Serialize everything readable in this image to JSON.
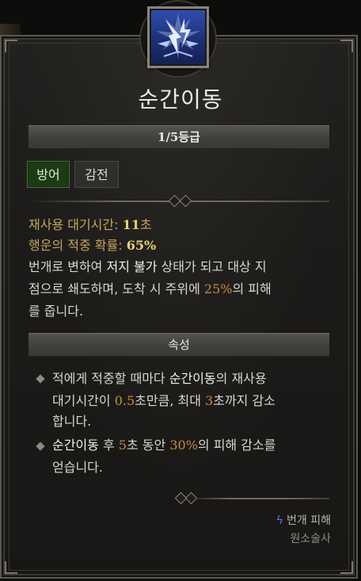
{
  "skill": {
    "name": "순간이동",
    "rank": "1/5등급",
    "tags": [
      "방어",
      "감전"
    ]
  },
  "stats": {
    "cooldown_label": "재사용 대기시간:",
    "cooldown_value": "11",
    "cooldown_unit": "초",
    "luck_label": "행운의 적중 확률:",
    "luck_value": "65%"
  },
  "description": {
    "l1a": "번개로 변하여 ",
    "l1b": "저지 불가",
    "l1c": " 상태가 되고 대상 지",
    "l2a": "점으로 쇄도하며, 도착 시 주위에 ",
    "l2b": "25%",
    "l2c": "의 피해",
    "l3": "를 줍니다."
  },
  "attributes": {
    "title": "속성",
    "b1_l1a": "적에게 적중할 때마다 ",
    "b1_l1b": "순간이동",
    "b1_l1c": "의 재사용",
    "b1_l2a": "대기시간이 ",
    "b1_l2b": "0.5",
    "b1_l2c": "초만큼, 최대 ",
    "b1_l2d": "3",
    "b1_l2e": "초까지 감소",
    "b1_l3": "합니다.",
    "b2_l1a": "순간이동",
    "b2_l1b": " 후 ",
    "b2_l1c": "5",
    "b2_l1d": "초 동안 ",
    "b2_l1e": "30%",
    "b2_l1f": "의 피해 감소를",
    "b2_l2": "얻습니다."
  },
  "footer": {
    "damage_type": "번개 피해",
    "class_name": "원소술사",
    "icon": "lightning-bolt-icon"
  },
  "colors": {
    "label": "#c9a55a",
    "value": "#e9d36b",
    "highlight": "#c98c3a",
    "tag_active": "#1d3a16",
    "icon_blue": "#2f4fb0"
  }
}
